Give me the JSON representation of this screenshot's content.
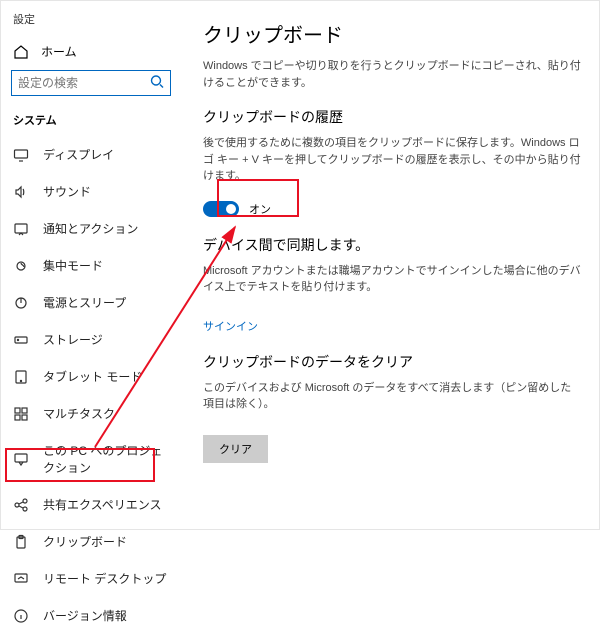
{
  "app_title": "設定",
  "home_label": "ホーム",
  "search_placeholder": "設定の検索",
  "category_title": "システム",
  "sidebar": {
    "items": [
      {
        "label": "ディスプレイ"
      },
      {
        "label": "サウンド"
      },
      {
        "label": "通知とアクション"
      },
      {
        "label": "集中モード"
      },
      {
        "label": "電源とスリープ"
      },
      {
        "label": "ストレージ"
      },
      {
        "label": "タブレット モード"
      },
      {
        "label": "マルチタスク"
      },
      {
        "label": "この PC へのプロジェクション"
      },
      {
        "label": "共有エクスペリエンス"
      },
      {
        "label": "クリップボード"
      },
      {
        "label": "リモート デスクトップ"
      },
      {
        "label": "バージョン情報"
      }
    ]
  },
  "page": {
    "title": "クリップボード",
    "intro": "Windows でコピーや切り取りを行うとクリップボードにコピーされ、貼り付けることができます。"
  },
  "history": {
    "title": "クリップボードの履歴",
    "desc": "後で使用するために複数の項目をクリップボードに保存します。Windows ロゴ キー + V キーを押してクリップボードの履歴を表示し、その中から貼り付けます。",
    "toggle_label": "オン",
    "toggle_on": true
  },
  "sync": {
    "title": "デバイス間で同期します。",
    "desc": "Microsoft アカウントまたは職場アカウントでサインインした場合に他のデバイス上でテキストを貼り付けます。",
    "link": "サインイン"
  },
  "clear": {
    "title": "クリップボードのデータをクリア",
    "desc": "このデバイスおよび Microsoft のデータをすべて消去します（ピン留めした項目は除く）。",
    "button": "クリア"
  }
}
